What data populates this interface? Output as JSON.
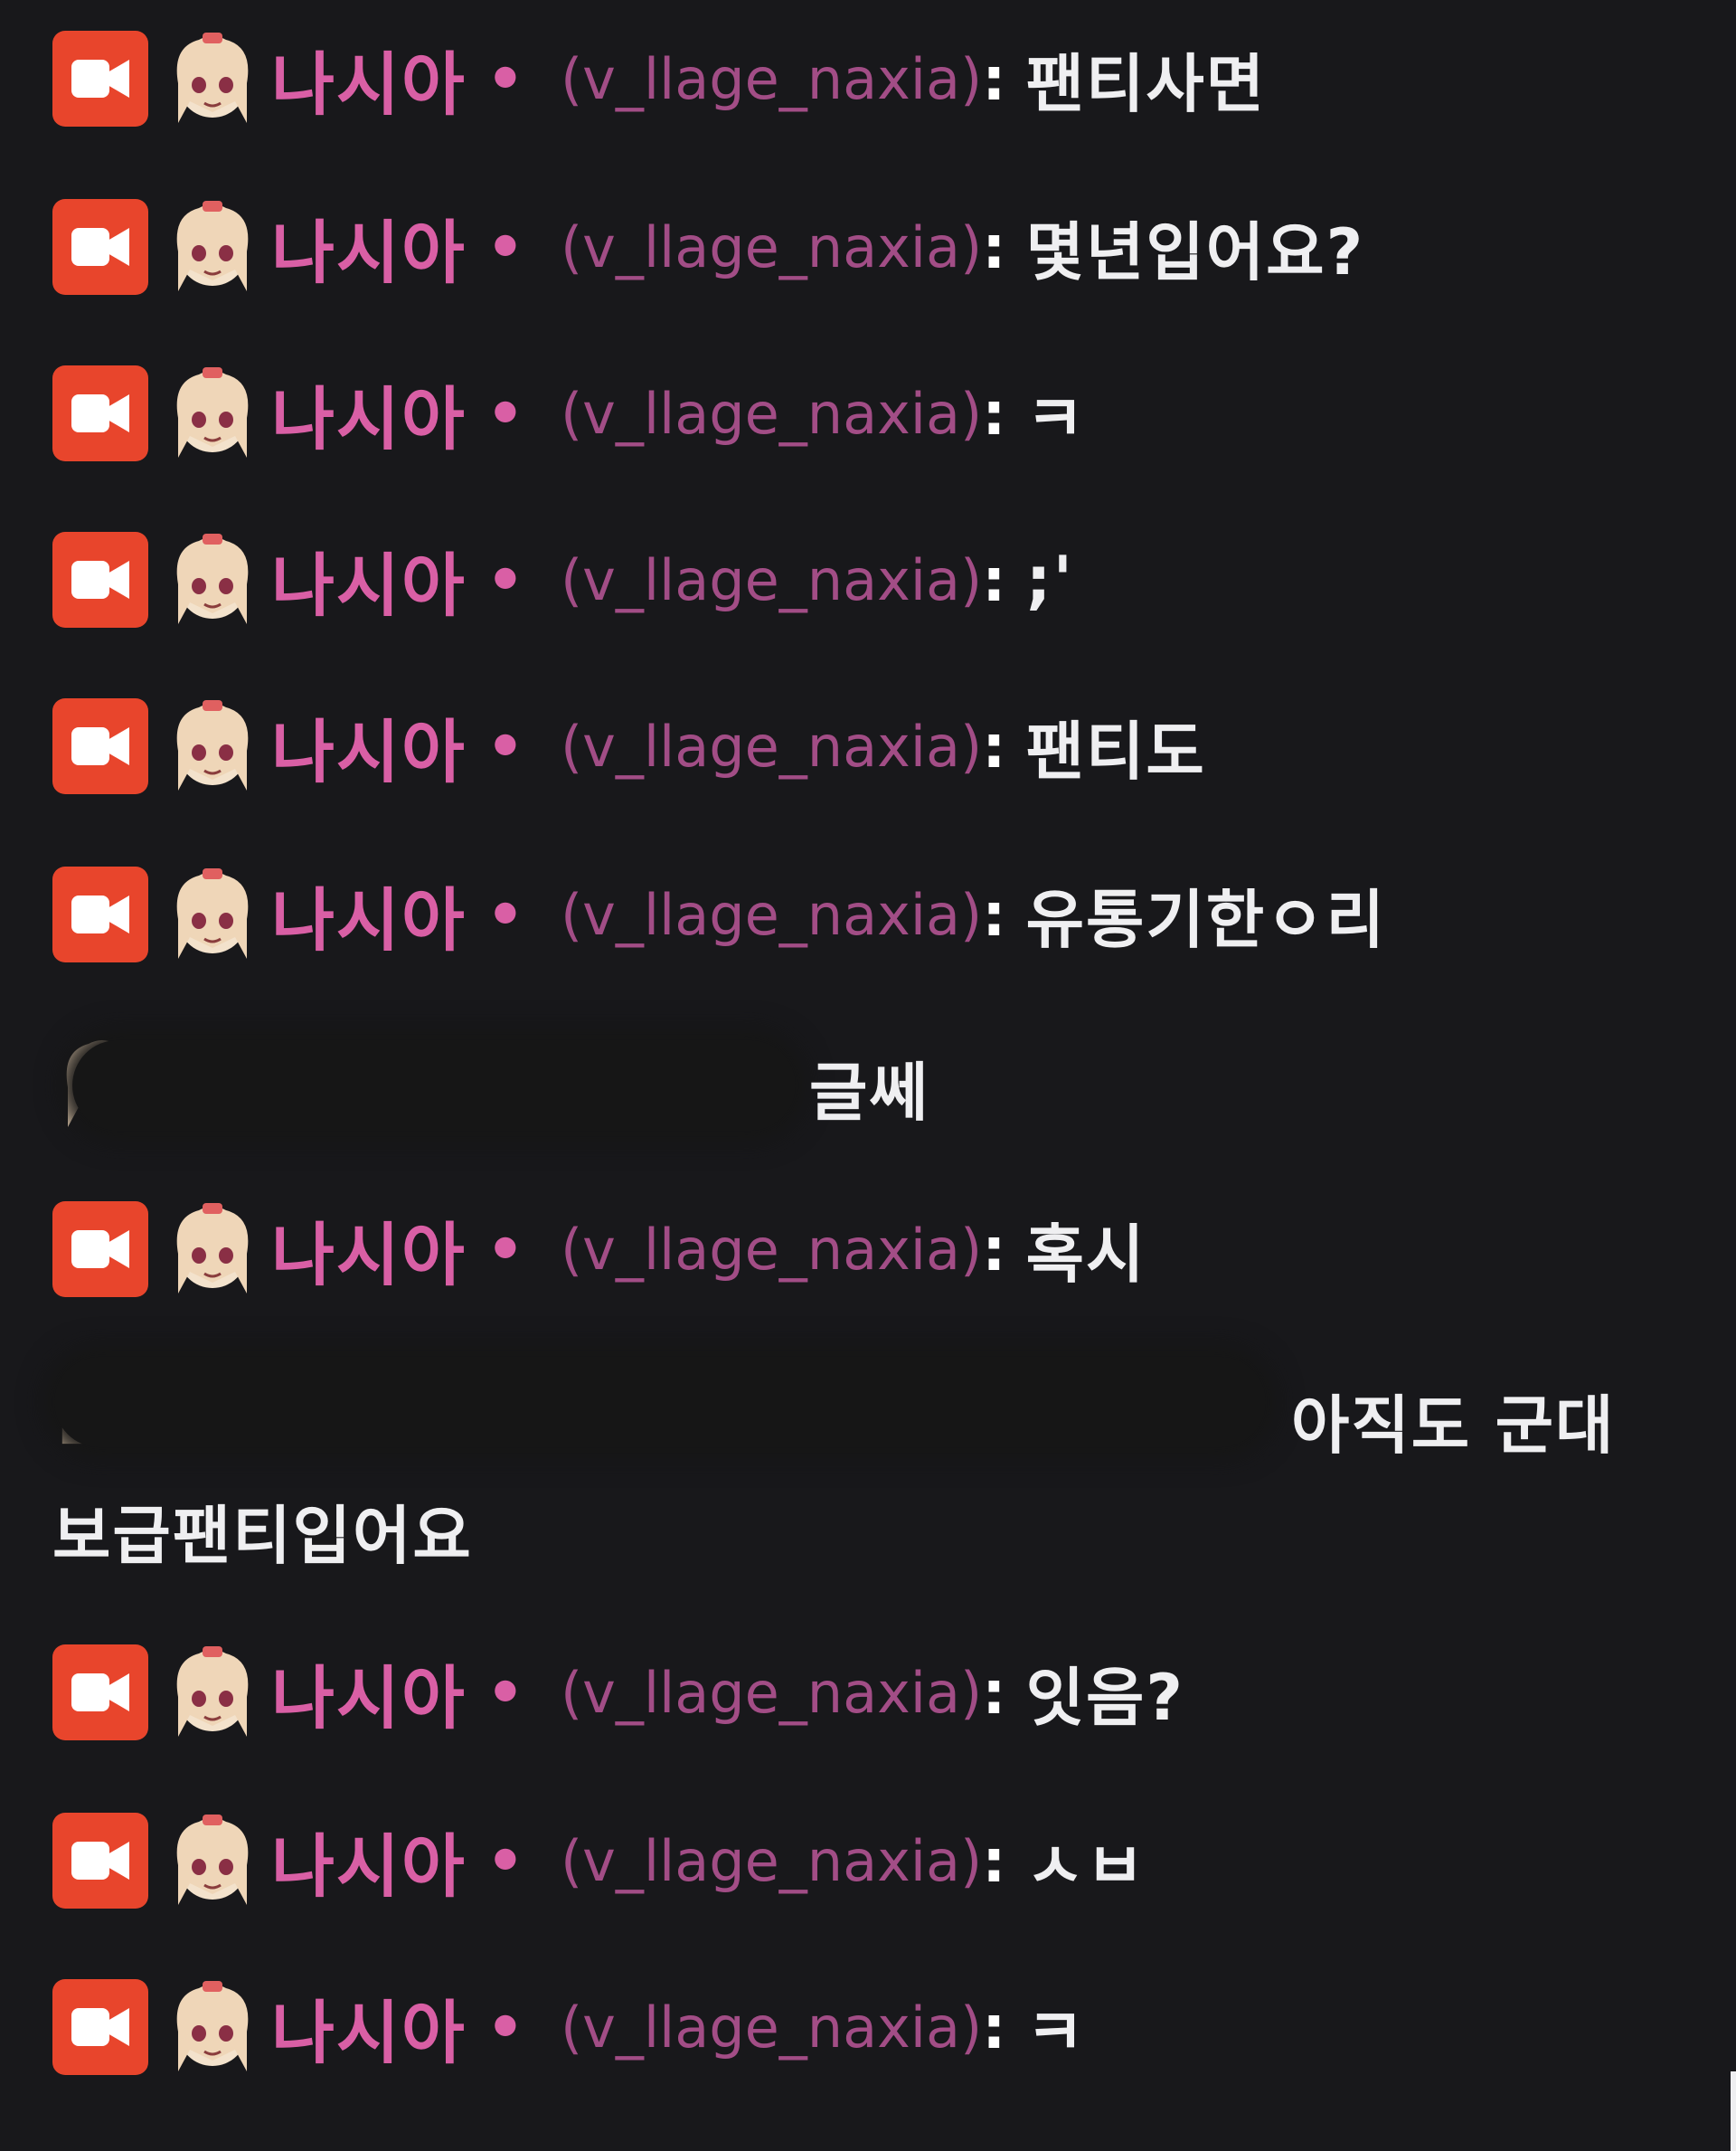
{
  "colors": {
    "background": "#18181b",
    "badge": "#e8452c",
    "display_name": "#d95fa5",
    "login": "#a24d86",
    "message_text": "#efeff1"
  },
  "icons": {
    "badge": "video-camera-icon",
    "avatar": "anime-girl-emote-icon"
  },
  "user": {
    "display_name": "나시아",
    "separator_dot": "•",
    "login": "(v_llage_naxia)",
    "colon": ":"
  },
  "messages": [
    {
      "text": "팬티사면"
    },
    {
      "text": "몇년입어요?"
    },
    {
      "text": "ㅋ"
    },
    {
      "text": ";'"
    },
    {
      "text": "팬티도"
    },
    {
      "text": "유통기한ㅇ리"
    },
    {
      "text": "글쎄",
      "redacted_sender": true
    },
    {
      "text": "혹시"
    },
    {
      "text": "아직도 군대",
      "continuation": "보급팬티입어요",
      "redacted_sender": true
    },
    {
      "text": "잇음?"
    },
    {
      "text": "ㅅㅂ"
    },
    {
      "text": "ㅋ"
    }
  ]
}
